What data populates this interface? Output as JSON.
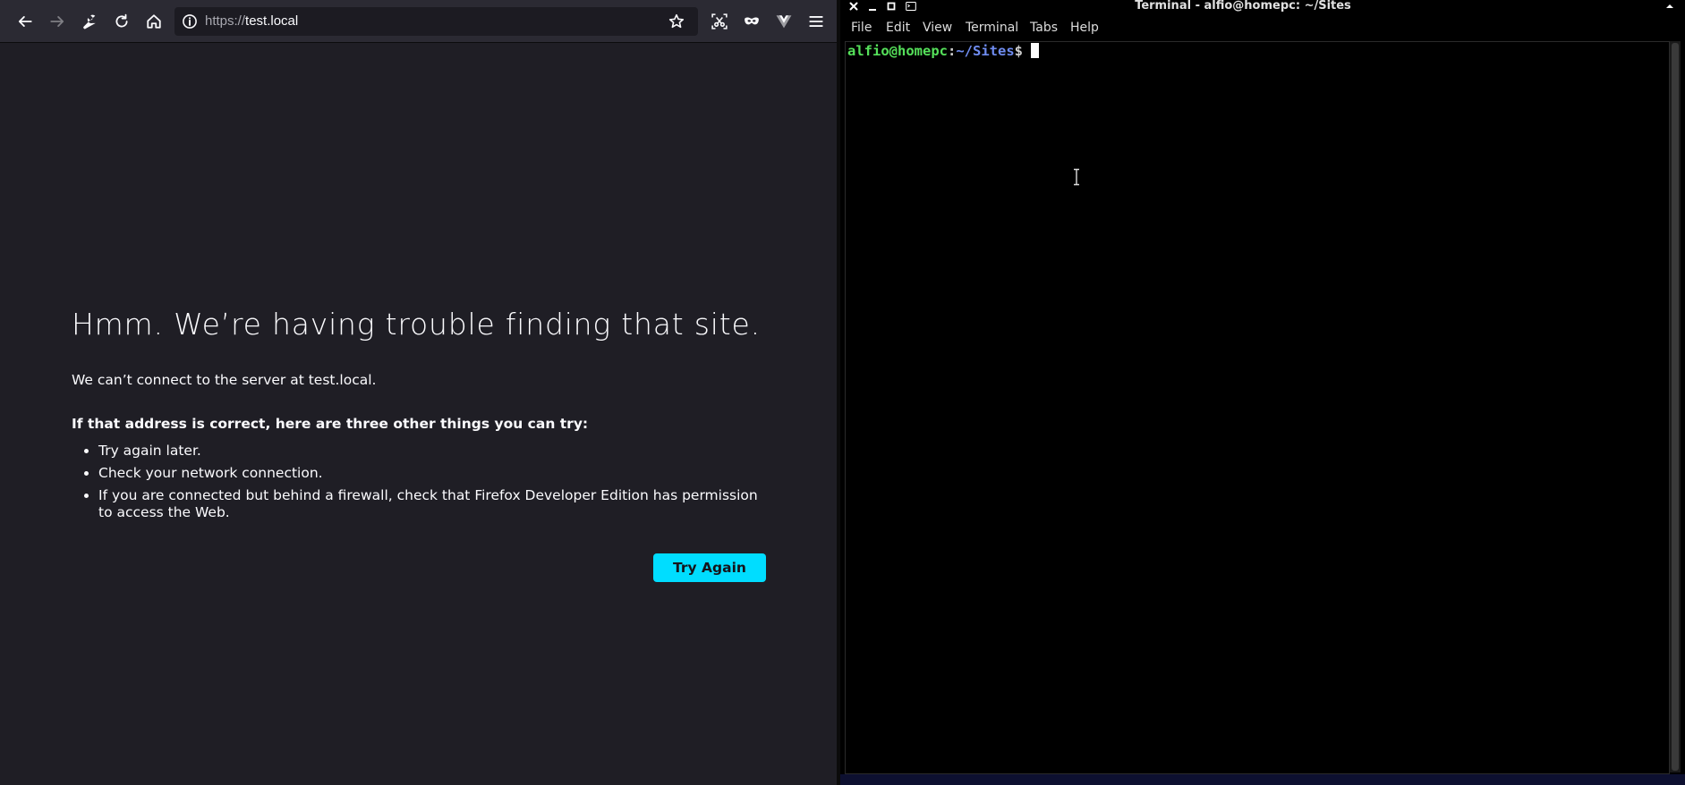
{
  "browser": {
    "toolbar": {
      "back_icon": "arrow-left-icon",
      "forward_icon": "arrow-right-icon",
      "tools_icon": "wrench-icon",
      "reload_icon": "reload-icon",
      "home_icon": "home-icon",
      "url_prefix": "https://",
      "url_host": "test.local",
      "bookmark_icon": "star-icon",
      "screenshot_icon": "screenshot-icon",
      "private_icon": "mask-icon",
      "extension_icon": "vue-devtools-icon",
      "menu_icon": "hamburger-menu-icon"
    },
    "error": {
      "title": "Hmm. We’re having trouble finding that site.",
      "description": "We can’t connect to the server at test.local.",
      "suggest_heading": "If that address is correct, here are three other things you can try:",
      "suggestions": [
        "Try again later.",
        "Check your network connection.",
        "If you are connected but behind a firewall, check that Firefox Developer Edition has permission to access the Web."
      ],
      "button_label": "Try Again"
    },
    "colors": {
      "background": "#1f1e25",
      "toolbar": "#2b2a33",
      "accent": "#00ddff"
    }
  },
  "terminal": {
    "title": "Terminal - alfio@homepc: ~/Sites",
    "menu": [
      "File",
      "Edit",
      "View",
      "Terminal",
      "Tabs",
      "Help"
    ],
    "prompt": {
      "user_host": "alfio@homepc",
      "separator": ":",
      "path": "~/Sites",
      "symbol": "$"
    },
    "colors": {
      "background": "#000000",
      "user": "#55e05a",
      "path": "#6f8cf0"
    }
  }
}
